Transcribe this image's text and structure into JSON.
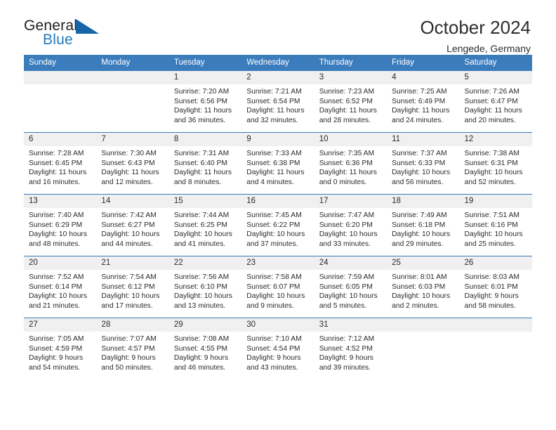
{
  "brand": {
    "name_part1": "General",
    "name_part2": "Blue",
    "flag_icon": "blue-triangle-flag-icon",
    "accent_color": "#1f7ac2"
  },
  "header": {
    "title": "October 2024",
    "subtitle": "Lengede, Germany"
  },
  "colors": {
    "header_blue": "#3b7cbd",
    "daynum_band": "#f0f0f0",
    "text": "#2b2b2b"
  },
  "weekday_headers": [
    "Sunday",
    "Monday",
    "Tuesday",
    "Wednesday",
    "Thursday",
    "Friday",
    "Saturday"
  ],
  "weeks": [
    [
      {
        "day": "",
        "empty": true,
        "sunrise": "",
        "sunset": "",
        "daylight1": "",
        "daylight2": ""
      },
      {
        "day": "",
        "empty": true,
        "sunrise": "",
        "sunset": "",
        "daylight1": "",
        "daylight2": ""
      },
      {
        "day": "1",
        "sunrise": "Sunrise: 7:20 AM",
        "sunset": "Sunset: 6:56 PM",
        "daylight1": "Daylight: 11 hours",
        "daylight2": "and 36 minutes."
      },
      {
        "day": "2",
        "sunrise": "Sunrise: 7:21 AM",
        "sunset": "Sunset: 6:54 PM",
        "daylight1": "Daylight: 11 hours",
        "daylight2": "and 32 minutes."
      },
      {
        "day": "3",
        "sunrise": "Sunrise: 7:23 AM",
        "sunset": "Sunset: 6:52 PM",
        "daylight1": "Daylight: 11 hours",
        "daylight2": "and 28 minutes."
      },
      {
        "day": "4",
        "sunrise": "Sunrise: 7:25 AM",
        "sunset": "Sunset: 6:49 PM",
        "daylight1": "Daylight: 11 hours",
        "daylight2": "and 24 minutes."
      },
      {
        "day": "5",
        "sunrise": "Sunrise: 7:26 AM",
        "sunset": "Sunset: 6:47 PM",
        "daylight1": "Daylight: 11 hours",
        "daylight2": "and 20 minutes."
      }
    ],
    [
      {
        "day": "6",
        "sunrise": "Sunrise: 7:28 AM",
        "sunset": "Sunset: 6:45 PM",
        "daylight1": "Daylight: 11 hours",
        "daylight2": "and 16 minutes."
      },
      {
        "day": "7",
        "sunrise": "Sunrise: 7:30 AM",
        "sunset": "Sunset: 6:43 PM",
        "daylight1": "Daylight: 11 hours",
        "daylight2": "and 12 minutes."
      },
      {
        "day": "8",
        "sunrise": "Sunrise: 7:31 AM",
        "sunset": "Sunset: 6:40 PM",
        "daylight1": "Daylight: 11 hours",
        "daylight2": "and 8 minutes."
      },
      {
        "day": "9",
        "sunrise": "Sunrise: 7:33 AM",
        "sunset": "Sunset: 6:38 PM",
        "daylight1": "Daylight: 11 hours",
        "daylight2": "and 4 minutes."
      },
      {
        "day": "10",
        "sunrise": "Sunrise: 7:35 AM",
        "sunset": "Sunset: 6:36 PM",
        "daylight1": "Daylight: 11 hours",
        "daylight2": "and 0 minutes."
      },
      {
        "day": "11",
        "sunrise": "Sunrise: 7:37 AM",
        "sunset": "Sunset: 6:33 PM",
        "daylight1": "Daylight: 10 hours",
        "daylight2": "and 56 minutes."
      },
      {
        "day": "12",
        "sunrise": "Sunrise: 7:38 AM",
        "sunset": "Sunset: 6:31 PM",
        "daylight1": "Daylight: 10 hours",
        "daylight2": "and 52 minutes."
      }
    ],
    [
      {
        "day": "13",
        "sunrise": "Sunrise: 7:40 AM",
        "sunset": "Sunset: 6:29 PM",
        "daylight1": "Daylight: 10 hours",
        "daylight2": "and 48 minutes."
      },
      {
        "day": "14",
        "sunrise": "Sunrise: 7:42 AM",
        "sunset": "Sunset: 6:27 PM",
        "daylight1": "Daylight: 10 hours",
        "daylight2": "and 44 minutes."
      },
      {
        "day": "15",
        "sunrise": "Sunrise: 7:44 AM",
        "sunset": "Sunset: 6:25 PM",
        "daylight1": "Daylight: 10 hours",
        "daylight2": "and 41 minutes."
      },
      {
        "day": "16",
        "sunrise": "Sunrise: 7:45 AM",
        "sunset": "Sunset: 6:22 PM",
        "daylight1": "Daylight: 10 hours",
        "daylight2": "and 37 minutes."
      },
      {
        "day": "17",
        "sunrise": "Sunrise: 7:47 AM",
        "sunset": "Sunset: 6:20 PM",
        "daylight1": "Daylight: 10 hours",
        "daylight2": "and 33 minutes."
      },
      {
        "day": "18",
        "sunrise": "Sunrise: 7:49 AM",
        "sunset": "Sunset: 6:18 PM",
        "daylight1": "Daylight: 10 hours",
        "daylight2": "and 29 minutes."
      },
      {
        "day": "19",
        "sunrise": "Sunrise: 7:51 AM",
        "sunset": "Sunset: 6:16 PM",
        "daylight1": "Daylight: 10 hours",
        "daylight2": "and 25 minutes."
      }
    ],
    [
      {
        "day": "20",
        "sunrise": "Sunrise: 7:52 AM",
        "sunset": "Sunset: 6:14 PM",
        "daylight1": "Daylight: 10 hours",
        "daylight2": "and 21 minutes."
      },
      {
        "day": "21",
        "sunrise": "Sunrise: 7:54 AM",
        "sunset": "Sunset: 6:12 PM",
        "daylight1": "Daylight: 10 hours",
        "daylight2": "and 17 minutes."
      },
      {
        "day": "22",
        "sunrise": "Sunrise: 7:56 AM",
        "sunset": "Sunset: 6:10 PM",
        "daylight1": "Daylight: 10 hours",
        "daylight2": "and 13 minutes."
      },
      {
        "day": "23",
        "sunrise": "Sunrise: 7:58 AM",
        "sunset": "Sunset: 6:07 PM",
        "daylight1": "Daylight: 10 hours",
        "daylight2": "and 9 minutes."
      },
      {
        "day": "24",
        "sunrise": "Sunrise: 7:59 AM",
        "sunset": "Sunset: 6:05 PM",
        "daylight1": "Daylight: 10 hours",
        "daylight2": "and 5 minutes."
      },
      {
        "day": "25",
        "sunrise": "Sunrise: 8:01 AM",
        "sunset": "Sunset: 6:03 PM",
        "daylight1": "Daylight: 10 hours",
        "daylight2": "and 2 minutes."
      },
      {
        "day": "26",
        "sunrise": "Sunrise: 8:03 AM",
        "sunset": "Sunset: 6:01 PM",
        "daylight1": "Daylight: 9 hours",
        "daylight2": "and 58 minutes."
      }
    ],
    [
      {
        "day": "27",
        "sunrise": "Sunrise: 7:05 AM",
        "sunset": "Sunset: 4:59 PM",
        "daylight1": "Daylight: 9 hours",
        "daylight2": "and 54 minutes."
      },
      {
        "day": "28",
        "sunrise": "Sunrise: 7:07 AM",
        "sunset": "Sunset: 4:57 PM",
        "daylight1": "Daylight: 9 hours",
        "daylight2": "and 50 minutes."
      },
      {
        "day": "29",
        "sunrise": "Sunrise: 7:08 AM",
        "sunset": "Sunset: 4:55 PM",
        "daylight1": "Daylight: 9 hours",
        "daylight2": "and 46 minutes."
      },
      {
        "day": "30",
        "sunrise": "Sunrise: 7:10 AM",
        "sunset": "Sunset: 4:54 PM",
        "daylight1": "Daylight: 9 hours",
        "daylight2": "and 43 minutes."
      },
      {
        "day": "31",
        "sunrise": "Sunrise: 7:12 AM",
        "sunset": "Sunset: 4:52 PM",
        "daylight1": "Daylight: 9 hours",
        "daylight2": "and 39 minutes."
      },
      {
        "day": "",
        "empty": true,
        "sunrise": "",
        "sunset": "",
        "daylight1": "",
        "daylight2": ""
      },
      {
        "day": "",
        "empty": true,
        "sunrise": "",
        "sunset": "",
        "daylight1": "",
        "daylight2": ""
      }
    ]
  ]
}
